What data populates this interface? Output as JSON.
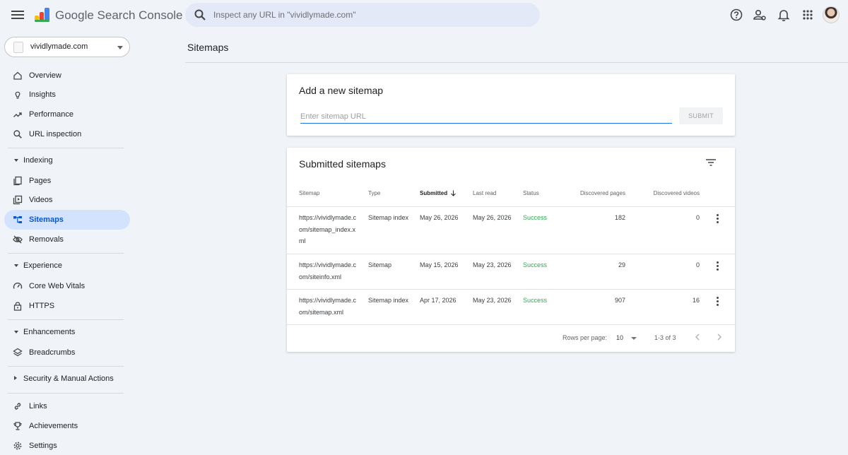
{
  "header": {
    "brand": "Google Search Console",
    "search_placeholder": "Inspect any URL in \"vividlymade.com\"",
    "icons": [
      "help-icon",
      "manage-users-icon",
      "notifications-icon",
      "apps-grid-icon"
    ]
  },
  "property": {
    "name": "vividlymade.com"
  },
  "sidebar": {
    "items": [
      {
        "label": "Overview",
        "icon": "home-icon"
      },
      {
        "label": "Insights",
        "icon": "lightbulb-icon"
      },
      {
        "label": "Performance",
        "icon": "trending-up-icon"
      },
      {
        "label": "URL inspection",
        "icon": "search-icon"
      }
    ],
    "indexing": {
      "label": "Indexing",
      "items": [
        {
          "label": "Pages",
          "icon": "pages-icon"
        },
        {
          "label": "Videos",
          "icon": "video-icon"
        },
        {
          "label": "Sitemaps",
          "icon": "sitemap-icon",
          "active": true
        },
        {
          "label": "Removals",
          "icon": "visibility-off-icon"
        }
      ]
    },
    "experience": {
      "label": "Experience",
      "items": [
        {
          "label": "Core Web Vitals",
          "icon": "speed-icon"
        },
        {
          "label": "HTTPS",
          "icon": "lock-icon"
        }
      ]
    },
    "enhancements": {
      "label": "Enhancements",
      "items": [
        {
          "label": "Breadcrumbs",
          "icon": "layers-icon"
        }
      ]
    },
    "security": {
      "label": "Security & Manual Actions"
    },
    "bottom": [
      {
        "label": "Links",
        "icon": "link-icon"
      },
      {
        "label": "Achievements",
        "icon": "trophy-icon"
      },
      {
        "label": "Settings",
        "icon": "gear-icon"
      }
    ]
  },
  "main": {
    "title": "Sitemaps",
    "add_card": {
      "title": "Add a new sitemap",
      "placeholder": "Enter sitemap URL",
      "submit_label": "SUBMIT"
    },
    "submitted_card": {
      "title": "Submitted sitemaps",
      "columns": [
        "Sitemap",
        "Type",
        "Submitted",
        "Last read",
        "Status",
        "Discovered pages",
        "Discovered videos"
      ],
      "rows": [
        {
          "sitemap": "https://vividlymade.com/sitemap_index.xml",
          "type": "Sitemap index",
          "submitted": "May 26, 2026",
          "last_read": "May 26, 2026",
          "status": "Success",
          "pages": "182",
          "videos": "0"
        },
        {
          "sitemap": "https://vividlymade.com/siteinfo.xml",
          "type": "Sitemap",
          "submitted": "May 15, 2026",
          "last_read": "May 23, 2026",
          "status": "Success",
          "pages": "29",
          "videos": "0"
        },
        {
          "sitemap": "https://vividlymade.com/sitemap.xml",
          "type": "Sitemap index",
          "submitted": "Apr 17, 2026",
          "last_read": "May 23, 2026",
          "status": "Success",
          "pages": "907",
          "videos": "16"
        }
      ],
      "pager": {
        "rows_label": "Rows per page:",
        "rows_value": "10",
        "range": "1-3 of 3"
      }
    }
  },
  "colors": {
    "accent": "#1a73e8",
    "active_bg": "#d3e3fd",
    "success": "#34a853",
    "background": "#f0f4f9"
  }
}
